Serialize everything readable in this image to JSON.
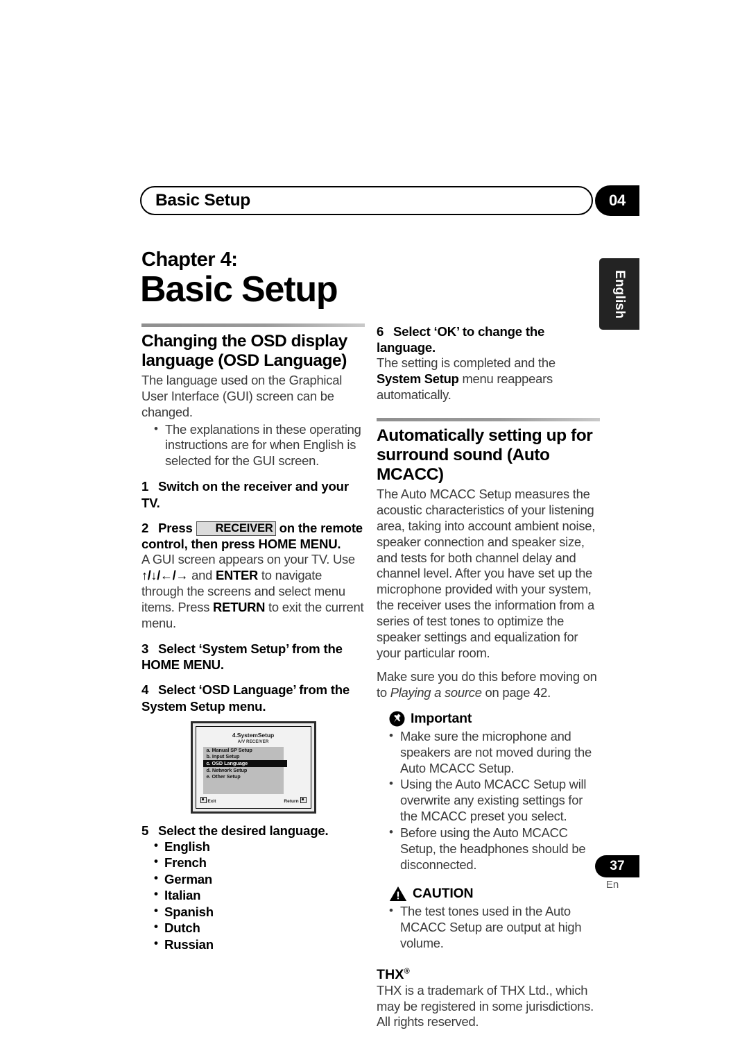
{
  "header": {
    "running_title": "Basic Setup",
    "chapter_number": "04",
    "side_tab": "English"
  },
  "chapter": {
    "label": "Chapter 4:",
    "title": "Basic Setup"
  },
  "left_column": {
    "section1": {
      "heading_line1": "Changing the OSD display",
      "heading_line2": "language (OSD Language)",
      "intro": "The language used on the Graphical User Interface (GUI) screen can be changed.",
      "bullets": [
        "The explanations in these operating instructions are for when English is selected for the GUI screen."
      ],
      "steps": [
        {
          "num": "1",
          "title": "Switch on the receiver and your TV.",
          "body": ""
        },
        {
          "num": "2",
          "title_pre": "Press",
          "key": "RECEIVER",
          "title_post": "on the remote control, then press HOME MENU.",
          "body_pre": "A GUI screen appears on your TV. Use ",
          "body_arrows1": "↑/↓/",
          "body_arrows2": "←/→",
          "body_mid1": " and ",
          "body_enter": "ENTER",
          "body_mid2": " to navigate through the screens and select menu items. Press ",
          "body_return": "RETURN",
          "body_end": " to exit the current menu."
        },
        {
          "num": "3",
          "title": "Select ‘System Setup’ from the HOME MENU."
        },
        {
          "num": "4",
          "title": "Select ‘OSD Language’ from the System Setup menu."
        },
        {
          "num": "5",
          "title": "Select the desired language."
        }
      ],
      "languages": [
        "English",
        "French",
        "German",
        "Italian",
        "Spanish",
        "Dutch",
        "Russian"
      ]
    },
    "osd_screen": {
      "title": "4.SystemSetup",
      "subtitle": "A/V RECEIVER",
      "items": [
        {
          "label": "a. Manual SP Setup",
          "selected": false
        },
        {
          "label": "b. Input Setup",
          "selected": false
        },
        {
          "label": "c. OSD Language",
          "selected": true
        },
        {
          "label": "d. Network Setup",
          "selected": false
        },
        {
          "label": "e. Other Setup",
          "selected": false
        }
      ],
      "footer_left": "Exit",
      "footer_right": "Return"
    }
  },
  "right_column": {
    "step6": {
      "num": "6",
      "title": "Select ‘OK’ to change the language.",
      "body_pre": "The setting is completed and the ",
      "body_bold": "System Setup",
      "body_post": " menu reappears automatically."
    },
    "section2": {
      "heading_line1": "Automatically setting up for",
      "heading_line2": "surround sound (Auto MCACC)",
      "paragraph1": "The Auto MCACC Setup measures the acoustic characteristics of your listening area, taking into account ambient noise, speaker connection and speaker size, and tests for both channel delay and channel level. After you have set up the microphone provided with your system, the receiver uses the information from a series of test tones to optimize the speaker settings and equalization for your particular room.",
      "paragraph2_pre": "Make sure you do this before moving on to ",
      "paragraph2_italic": "Playing a source",
      "paragraph2_post": " on page 42."
    },
    "important": {
      "label": "Important",
      "icon": "pushpin-icon",
      "bullets": [
        "Make sure the microphone and speakers are not moved during the Auto MCACC Setup.",
        "Using the Auto MCACC Setup will overwrite any existing settings for the MCACC preset you select.",
        "Before using the Auto MCACC Setup, the headphones should be disconnected."
      ]
    },
    "caution": {
      "label": "CAUTION",
      "icon": "warning-triangle-icon",
      "bullets": [
        "The test tones used in the Auto MCACC Setup are output at high volume."
      ]
    },
    "thx": {
      "heading": "THX",
      "registered": "®",
      "body": "THX is a trademark of THX Ltd., which may be registered in some jurisdictions. All rights reserved."
    }
  },
  "footer": {
    "page_number": "37",
    "language_code": "En"
  }
}
